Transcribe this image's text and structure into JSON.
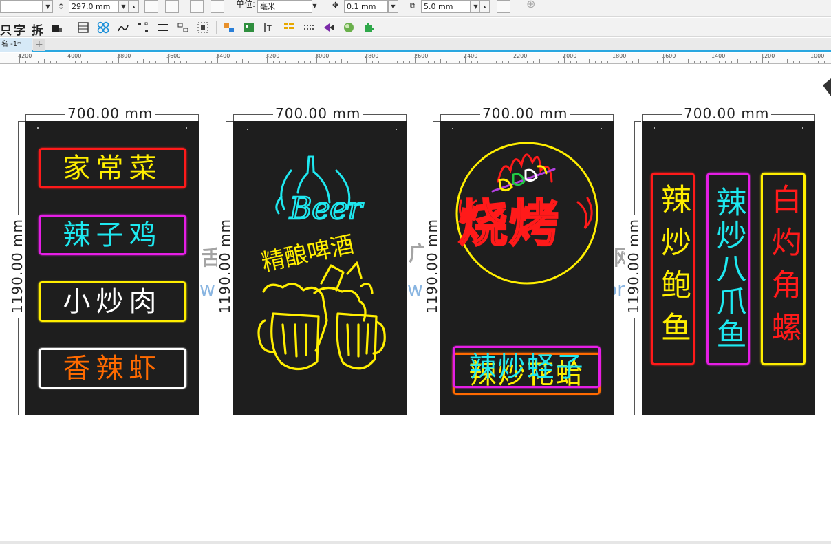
{
  "property_bar": {
    "page_height": "297.0 mm",
    "units_label": "单位:",
    "units_value": "毫米",
    "nudge_value": "0.1 mm",
    "duplicate_distance": "5.0 mm"
  },
  "toolbar": {
    "glyphs": [
      "只",
      "字",
      "拆"
    ]
  },
  "doc_tab": {
    "label": "名 -1*",
    "add": "+"
  },
  "ruler": {
    "labels": [
      "4200",
      "4000",
      "3800",
      "3600",
      "3400",
      "3200",
      "3000",
      "2800",
      "2600",
      "2400",
      "2200",
      "2000",
      "1800",
      "1600",
      "1400",
      "1200",
      "1000"
    ]
  },
  "dimensions": {
    "width": "700.00 mm",
    "height": "1190.00 mm"
  },
  "watermark": {
    "a": "舌",
    "b": "广",
    "c": "网",
    "url_a": "w",
    "url_b": "ww",
    "url_c": "om"
  },
  "colors": {
    "board": "#1e1e1e",
    "red": "#ff1a1a",
    "yellow": "#ffee00",
    "magenta": "#e51ee5",
    "cyan": "#1ee8f0",
    "white": "#ffffff",
    "orange": "#ff6a00"
  },
  "panel1": {
    "items": [
      {
        "text": "家常菜",
        "border": "#ff1a1a",
        "color": "#ffee00"
      },
      {
        "text": "辣子鸡",
        "border": "#e51ee5",
        "color": "#1ee8f0"
      },
      {
        "text": "小炒肉",
        "border": "#ffee00",
        "color": "#ffffff"
      },
      {
        "text": "香辣虾",
        "border": "#ffffff",
        "color": "#ff6a00"
      }
    ]
  },
  "panel2": {
    "beer_text": "Beer",
    "subtitle": "精酿啤酒"
  },
  "panel3": {
    "bbq_text": "烧烤",
    "items": [
      {
        "text": "辣炒花蛤",
        "border": "#ff6a00",
        "color": "#ffee00"
      },
      {
        "text": "辣炒蛏子",
        "border": "#e51ee5",
        "color": "#1ee8f0"
      }
    ]
  },
  "panel4": {
    "items": [
      {
        "text": "辣炒鲍鱼",
        "border": "#ff1a1a",
        "color": "#ffee00"
      },
      {
        "text": "辣炒八爪鱼",
        "border": "#e51ee5",
        "color": "#1ee8f0"
      },
      {
        "text": "白灼角螺",
        "border": "#ffee00",
        "color": "#ff1a1a"
      }
    ]
  }
}
